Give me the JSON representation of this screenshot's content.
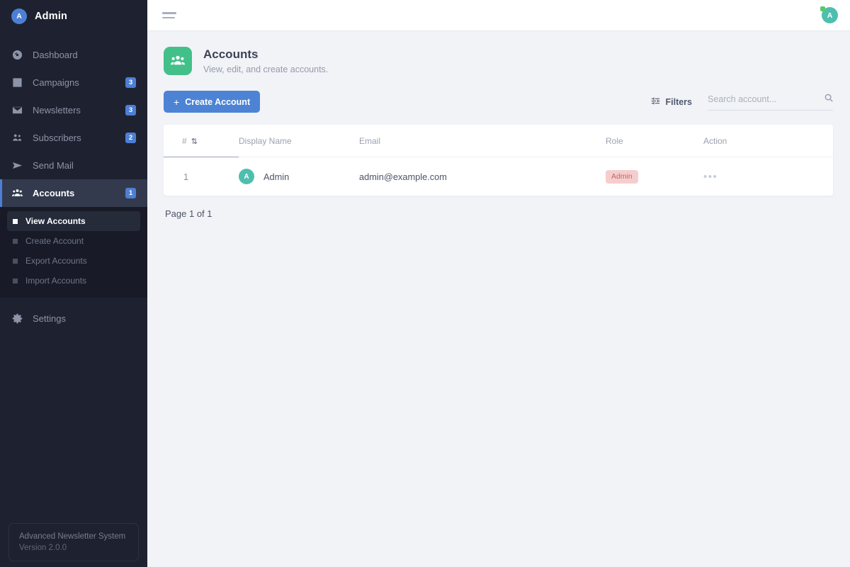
{
  "sidebar": {
    "brand": {
      "initial": "A",
      "name": "Admin"
    },
    "items": [
      {
        "label": "Dashboard",
        "icon": "dashboard-icon",
        "badge": null,
        "active": false
      },
      {
        "label": "Campaigns",
        "icon": "list-icon",
        "badge": "3",
        "active": false
      },
      {
        "label": "Newsletters",
        "icon": "envelope-icon",
        "badge": "3",
        "active": false
      },
      {
        "label": "Subscribers",
        "icon": "users-icon",
        "badge": "2",
        "active": false
      },
      {
        "label": "Send Mail",
        "icon": "paper-plane-icon",
        "badge": null,
        "active": false
      },
      {
        "label": "Accounts",
        "icon": "users-group-icon",
        "badge": "1",
        "active": true
      }
    ],
    "submenu": [
      {
        "label": "View Accounts",
        "active": true
      },
      {
        "label": "Create Account",
        "active": false
      },
      {
        "label": "Export Accounts",
        "active": false
      },
      {
        "label": "Import Accounts",
        "active": false
      }
    ],
    "settings": {
      "label": "Settings",
      "icon": "gear-icon"
    },
    "footer": {
      "product": "Advanced Newsletter System",
      "version": "Version 2.0.0"
    }
  },
  "topbar": {
    "menu_toggle": "hamburger-icon",
    "avatar": {
      "initial": "A",
      "status": "online"
    }
  },
  "page": {
    "icon": "users-group-icon",
    "title": "Accounts",
    "subtitle": "View, edit, and create accounts."
  },
  "toolbar": {
    "create_label": "Create Account",
    "create_plus": "+",
    "filters_label": "Filters",
    "search_placeholder": "Search account...",
    "search_value": ""
  },
  "table": {
    "columns": [
      {
        "key": "num",
        "label": "#",
        "sortable": true,
        "sort_glyph": "↓↑"
      },
      {
        "key": "name",
        "label": "Display Name",
        "sortable": false
      },
      {
        "key": "email",
        "label": "Email",
        "sortable": false
      },
      {
        "key": "role",
        "label": "Role",
        "sortable": false
      },
      {
        "key": "action",
        "label": "Action",
        "sortable": false
      }
    ],
    "rows": [
      {
        "num": "1",
        "avatar_initial": "A",
        "name": "Admin",
        "email": "admin@example.com",
        "role": "Admin",
        "action": "•••"
      }
    ]
  },
  "pagination": {
    "text": "Page 1 of 1"
  },
  "colors": {
    "sidebar_bg": "#1e2230",
    "submenu_bg": "#181b27",
    "accent_blue": "#4d83d4",
    "page_icon_green": "#43c08a",
    "avatar_teal": "#4ebfae",
    "role_badge_bg": "#f6cdcd",
    "role_badge_text": "#c4666a",
    "content_bg": "#f1f3f7"
  }
}
